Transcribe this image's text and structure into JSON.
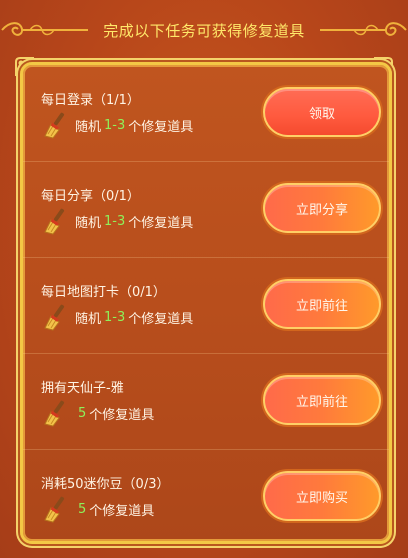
{
  "header": {
    "title": "完成以下任务可获得修复道具"
  },
  "tasks": [
    {
      "title": "每日登录（1/1）",
      "reward_prefix": "随机",
      "reward_amount": "1-3",
      "reward_suffix": "个修复道具",
      "button_label": "领取"
    },
    {
      "title": "每日分享（0/1）",
      "reward_prefix": "随机",
      "reward_amount": "1-3",
      "reward_suffix": "个修复道具",
      "button_label": "立即分享"
    },
    {
      "title": "每日地图打卡（0/1）",
      "reward_prefix": "随机",
      "reward_amount": "1-3",
      "reward_suffix": "个修复道具",
      "button_label": "立即前往"
    },
    {
      "title": "拥有天仙子-雅",
      "reward_prefix": "",
      "reward_amount": "5",
      "reward_suffix": "个修复道具",
      "button_label": "立即前往"
    },
    {
      "title": "消耗50迷你豆（0/3）",
      "reward_prefix": "",
      "reward_amount": "5",
      "reward_suffix": "个修复道具",
      "button_label": "立即购买"
    }
  ],
  "icons": {
    "reward_icon": "broom-icon",
    "header_ornament": "scroll-ornament-icon"
  },
  "colors": {
    "background": "#b7461a",
    "title_yellow": "#ffe86a",
    "reward_green": "#8ef05a",
    "button_red": "#ff5a3e",
    "border_gold": "#f3c845"
  }
}
